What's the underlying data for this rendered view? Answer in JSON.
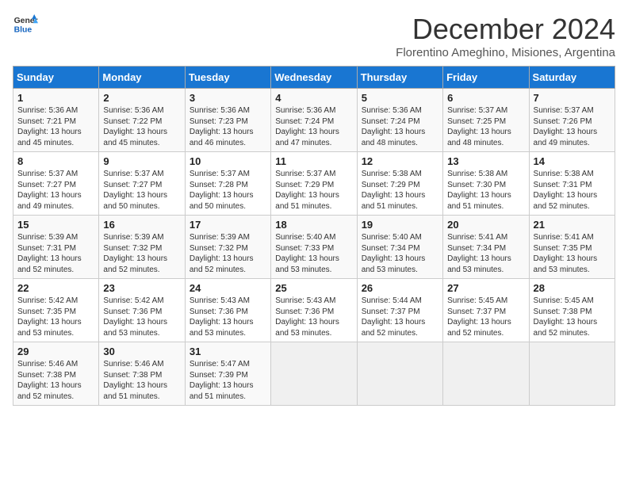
{
  "header": {
    "logo_general": "General",
    "logo_blue": "Blue",
    "month_title": "December 2024",
    "subtitle": "Florentino Ameghino, Misiones, Argentina"
  },
  "weekdays": [
    "Sunday",
    "Monday",
    "Tuesday",
    "Wednesday",
    "Thursday",
    "Friday",
    "Saturday"
  ],
  "weeks": [
    [
      {
        "day": "1",
        "sunrise": "5:36 AM",
        "sunset": "7:21 PM",
        "daylight": "13 hours and 45 minutes."
      },
      {
        "day": "2",
        "sunrise": "5:36 AM",
        "sunset": "7:22 PM",
        "daylight": "13 hours and 45 minutes."
      },
      {
        "day": "3",
        "sunrise": "5:36 AM",
        "sunset": "7:23 PM",
        "daylight": "13 hours and 46 minutes."
      },
      {
        "day": "4",
        "sunrise": "5:36 AM",
        "sunset": "7:24 PM",
        "daylight": "13 hours and 47 minutes."
      },
      {
        "day": "5",
        "sunrise": "5:36 AM",
        "sunset": "7:24 PM",
        "daylight": "13 hours and 48 minutes."
      },
      {
        "day": "6",
        "sunrise": "5:37 AM",
        "sunset": "7:25 PM",
        "daylight": "13 hours and 48 minutes."
      },
      {
        "day": "7",
        "sunrise": "5:37 AM",
        "sunset": "7:26 PM",
        "daylight": "13 hours and 49 minutes."
      }
    ],
    [
      {
        "day": "8",
        "sunrise": "5:37 AM",
        "sunset": "7:27 PM",
        "daylight": "13 hours and 49 minutes."
      },
      {
        "day": "9",
        "sunrise": "5:37 AM",
        "sunset": "7:27 PM",
        "daylight": "13 hours and 50 minutes."
      },
      {
        "day": "10",
        "sunrise": "5:37 AM",
        "sunset": "7:28 PM",
        "daylight": "13 hours and 50 minutes."
      },
      {
        "day": "11",
        "sunrise": "5:37 AM",
        "sunset": "7:29 PM",
        "daylight": "13 hours and 51 minutes."
      },
      {
        "day": "12",
        "sunrise": "5:38 AM",
        "sunset": "7:29 PM",
        "daylight": "13 hours and 51 minutes."
      },
      {
        "day": "13",
        "sunrise": "5:38 AM",
        "sunset": "7:30 PM",
        "daylight": "13 hours and 51 minutes."
      },
      {
        "day": "14",
        "sunrise": "5:38 AM",
        "sunset": "7:31 PM",
        "daylight": "13 hours and 52 minutes."
      }
    ],
    [
      {
        "day": "15",
        "sunrise": "5:39 AM",
        "sunset": "7:31 PM",
        "daylight": "13 hours and 52 minutes."
      },
      {
        "day": "16",
        "sunrise": "5:39 AM",
        "sunset": "7:32 PM",
        "daylight": "13 hours and 52 minutes."
      },
      {
        "day": "17",
        "sunrise": "5:39 AM",
        "sunset": "7:32 PM",
        "daylight": "13 hours and 52 minutes."
      },
      {
        "day": "18",
        "sunrise": "5:40 AM",
        "sunset": "7:33 PM",
        "daylight": "13 hours and 53 minutes."
      },
      {
        "day": "19",
        "sunrise": "5:40 AM",
        "sunset": "7:34 PM",
        "daylight": "13 hours and 53 minutes."
      },
      {
        "day": "20",
        "sunrise": "5:41 AM",
        "sunset": "7:34 PM",
        "daylight": "13 hours and 53 minutes."
      },
      {
        "day": "21",
        "sunrise": "5:41 AM",
        "sunset": "7:35 PM",
        "daylight": "13 hours and 53 minutes."
      }
    ],
    [
      {
        "day": "22",
        "sunrise": "5:42 AM",
        "sunset": "7:35 PM",
        "daylight": "13 hours and 53 minutes."
      },
      {
        "day": "23",
        "sunrise": "5:42 AM",
        "sunset": "7:36 PM",
        "daylight": "13 hours and 53 minutes."
      },
      {
        "day": "24",
        "sunrise": "5:43 AM",
        "sunset": "7:36 PM",
        "daylight": "13 hours and 53 minutes."
      },
      {
        "day": "25",
        "sunrise": "5:43 AM",
        "sunset": "7:36 PM",
        "daylight": "13 hours and 53 minutes."
      },
      {
        "day": "26",
        "sunrise": "5:44 AM",
        "sunset": "7:37 PM",
        "daylight": "13 hours and 52 minutes."
      },
      {
        "day": "27",
        "sunrise": "5:45 AM",
        "sunset": "7:37 PM",
        "daylight": "13 hours and 52 minutes."
      },
      {
        "day": "28",
        "sunrise": "5:45 AM",
        "sunset": "7:38 PM",
        "daylight": "13 hours and 52 minutes."
      }
    ],
    [
      {
        "day": "29",
        "sunrise": "5:46 AM",
        "sunset": "7:38 PM",
        "daylight": "13 hours and 52 minutes."
      },
      {
        "day": "30",
        "sunrise": "5:46 AM",
        "sunset": "7:38 PM",
        "daylight": "13 hours and 51 minutes."
      },
      {
        "day": "31",
        "sunrise": "5:47 AM",
        "sunset": "7:39 PM",
        "daylight": "13 hours and 51 minutes."
      },
      null,
      null,
      null,
      null
    ]
  ]
}
